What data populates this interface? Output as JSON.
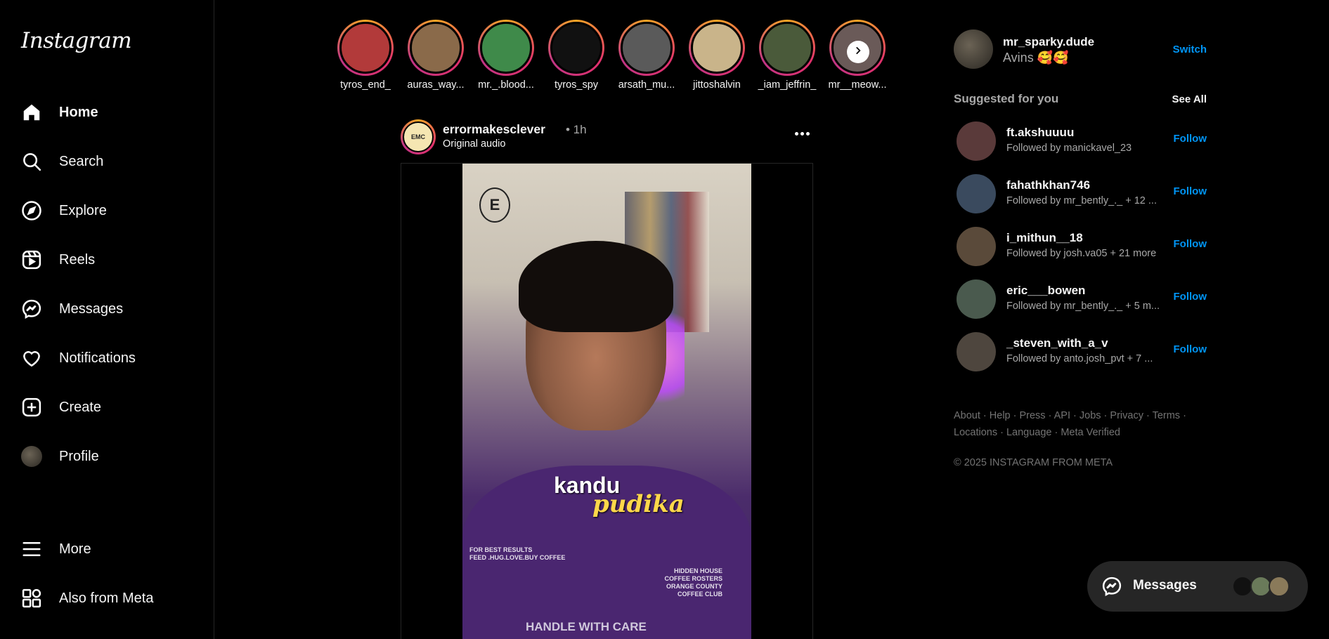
{
  "app": {
    "logo": "Instagram"
  },
  "nav": [
    {
      "id": "home",
      "label": "Home",
      "icon": "home-icon",
      "active": true
    },
    {
      "id": "search",
      "label": "Search",
      "icon": "search-icon"
    },
    {
      "id": "explore",
      "label": "Explore",
      "icon": "compass-icon"
    },
    {
      "id": "reels",
      "label": "Reels",
      "icon": "reels-icon"
    },
    {
      "id": "messages",
      "label": "Messages",
      "icon": "messenger-icon"
    },
    {
      "id": "notifications",
      "label": "Notifications",
      "icon": "heart-icon"
    },
    {
      "id": "create",
      "label": "Create",
      "icon": "plus-square-icon"
    },
    {
      "id": "profile",
      "label": "Profile",
      "icon": "avatar"
    },
    {
      "id": "more",
      "label": "More",
      "icon": "menu-icon"
    },
    {
      "id": "meta",
      "label": "Also from Meta",
      "icon": "grid-icon"
    }
  ],
  "stories": [
    {
      "name": "tyros_end_",
      "color": "#b23a3a"
    },
    {
      "name": "auras_way...",
      "color": "#8a6a4a"
    },
    {
      "name": "mr._.blood...",
      "color": "#3f8a4a"
    },
    {
      "name": "tyros_spy",
      "color": "#111111"
    },
    {
      "name": "arsath_mu...",
      "color": "#5a5a5a"
    },
    {
      "name": "jittoshalvin",
      "color": "#c9b48a"
    },
    {
      "name": "_iam_jeffrin_",
      "color": "#4a5a3a"
    },
    {
      "name": "mr__meow...",
      "color": "#6a5a58"
    }
  ],
  "post": {
    "username": "errormakesclever",
    "time": "• 1h",
    "audio": "Original audio",
    "avatar_text": "EMC",
    "video": {
      "logo_letter": "E",
      "caption_line1": "kandu",
      "caption_line2": "pudika",
      "shirt_left": "FOR BEST RESULTS\nFEED .HUG.LOVE.BUY COFFEE",
      "shirt_right": "HIDDEN HOUSE\nCOFFEE ROSTERS\nORANGE COUNTY\nCOFFEE CLUB",
      "shirt_bottom": "HANDLE WITH CARE"
    }
  },
  "account": {
    "username": "mr_sparky.dude",
    "name": "Avins 🥰🥰",
    "switch_label": "Switch"
  },
  "suggestions": {
    "title": "Suggested for you",
    "see_all": "See All",
    "follow_label": "Follow",
    "items": [
      {
        "username": "ft.akshuuuu",
        "subtitle": "Followed by manickavel_23",
        "color": "#5a3a3a"
      },
      {
        "username": "fahathkhan746",
        "subtitle": "Followed by mr_bently_._ + 12 ...",
        "color": "#3a4a5e"
      },
      {
        "username": "i_mithun__18",
        "subtitle": "Followed by josh.va05 + 21 more",
        "color": "#5a4a3a"
      },
      {
        "username": "eric___bowen",
        "subtitle": "Followed by mr_bently_._ + 5 m...",
        "color": "#4a5a4e"
      },
      {
        "username": "_steven_with_a_v",
        "subtitle": "Followed by anto.josh_pvt + 7 ...",
        "color": "#4e463e"
      }
    ]
  },
  "footer": {
    "links_line1": "About · Help · Press · API · Jobs · Privacy · Terms ·",
    "links_line2": "Locations · Language · Meta Verified",
    "copyright": "© 2025 INSTAGRAM FROM META"
  },
  "messages_pill": {
    "label": "Messages",
    "avatars": [
      "#111111",
      "#6a7a5a",
      "#8a7a5a"
    ]
  }
}
